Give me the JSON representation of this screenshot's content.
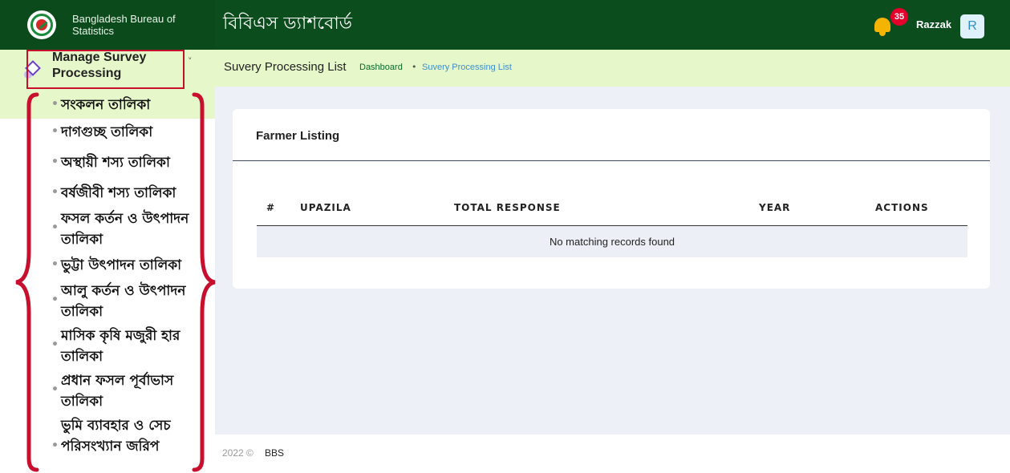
{
  "header": {
    "org_name": "Bangladesh Bureau of Statistics",
    "app_title": "বিবিএস ড্যাশবোর্ড",
    "notification_count": "35",
    "user_name": "Razzak",
    "avatar_initial": "R"
  },
  "sidebar": {
    "menu_title": "Manage Survey Processing",
    "chevron": "˅",
    "items": [
      {
        "label": "সংকলন তালিকা"
      },
      {
        "label": "দাগগুচ্ছ তালিকা"
      },
      {
        "label": "অস্থায়ী শস্য তালিকা"
      },
      {
        "label": "বর্ষজীবী শস্য তালিকা"
      },
      {
        "label": "ফসল কর্তন ও উৎপাদন তালিকা"
      },
      {
        "label": "ভুট্টা উৎপাদন তালিকা"
      },
      {
        "label": "আলু কর্তন ও উৎপাদন তালিকা"
      },
      {
        "label": "মাসিক কৃষি মজুরী হার তালিকা"
      },
      {
        "label": "প্রধান ফসল পূর্বাভাস তালিকা"
      },
      {
        "label": "ভুমি ব্যাবহার ও সেচ পরিসংখ্যান জরিপ"
      }
    ],
    "bullet": "•"
  },
  "breadcrumb": {
    "page_title": "Suvery Processing List",
    "home": "Dashboard",
    "separator": "•",
    "current": "Suvery Processing List"
  },
  "card": {
    "title": "Farmer Listing",
    "columns": [
      "#",
      "UPAZILA",
      "TOTAL RESPONSE",
      "YEAR",
      "ACTIONS"
    ],
    "empty_message": "No matching records found"
  },
  "footer": {
    "year": "2022 ©",
    "org": "BBS"
  },
  "colors": {
    "header_bg": "#0b4d1c",
    "highlight_bg": "#e6f7c9",
    "annotation_red": "#c8102e",
    "badge_red": "#e4002b"
  }
}
